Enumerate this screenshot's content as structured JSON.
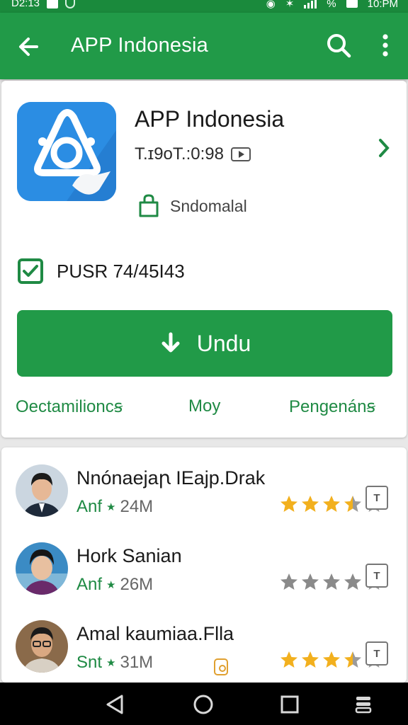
{
  "status_bar": {
    "time": "D2:13",
    "battery_text": "%",
    "clock": "10:PM"
  },
  "app_bar": {
    "title": "APP Indonesia",
    "icons": [
      "back-arrow-icon",
      "search-icon",
      "more-vert-icon"
    ]
  },
  "app": {
    "name": "APP Indonesia",
    "version": "T.ɪ9oT.:0:98",
    "developer": "Sndomalal",
    "pusr": "PUSR 74/45I43",
    "install_label": "Undu",
    "icon_color": "#2b8de3"
  },
  "tabs": [
    {
      "label": "Oectamilioncꞩ"
    },
    {
      "label": "Moy"
    },
    {
      "label": "Pengenánꞩ"
    }
  ],
  "reviews": [
    {
      "name": "Nnónaejaꞃ IEajp.Drak",
      "tag": "Anf",
      "count": "24M",
      "rating": 3.5,
      "star_color": "#f2b01e"
    },
    {
      "name": "Hork Sanian",
      "tag": "Anf",
      "count": "26M",
      "rating": 4,
      "star_color": "#8a8a8a"
    },
    {
      "name": "Amal kaumiaa.Flla",
      "tag": "Snt",
      "count": "31M",
      "rating": 3.5,
      "star_color": "#f2b01e"
    }
  ],
  "colors": {
    "primary": "#219a48",
    "status_bar": "#1a8a3c",
    "accent_text": "#1f8a44"
  }
}
